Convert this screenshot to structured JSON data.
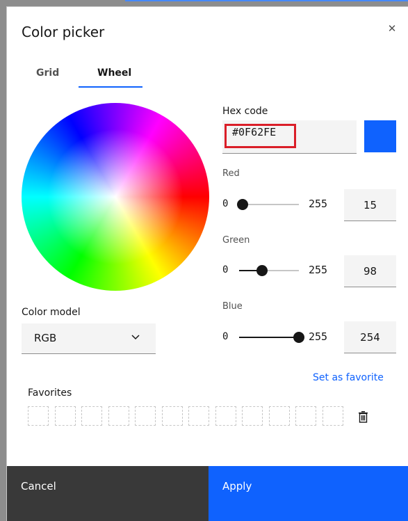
{
  "dialog": {
    "title": "Color picker",
    "close_icon": "close-icon"
  },
  "tabs": [
    {
      "label": "Grid",
      "selected": false
    },
    {
      "label": "Wheel",
      "selected": true
    }
  ],
  "hex": {
    "label": "Hex code",
    "value": "#0F62FE",
    "swatch_color": "#0F62FE"
  },
  "channels": {
    "red": {
      "label": "Red",
      "min": "0",
      "max": "255",
      "value": "15",
      "fraction": 0.0588
    },
    "green": {
      "label": "Green",
      "min": "0",
      "max": "255",
      "value": "98",
      "fraction": 0.3843
    },
    "blue": {
      "label": "Blue",
      "min": "0",
      "max": "255",
      "value": "254",
      "fraction": 0.9961
    }
  },
  "color_model": {
    "label": "Color model",
    "selected": "RGB"
  },
  "favorites": {
    "label": "Favorites",
    "set_label": "Set as favorite",
    "slot_count": 12,
    "delete_icon": "trash-icon"
  },
  "footer": {
    "cancel_label": "Cancel",
    "apply_label": "Apply"
  },
  "colors": {
    "accent": "#0F62FE",
    "highlight": "#DA1E28",
    "cancel_bg": "#393939"
  }
}
